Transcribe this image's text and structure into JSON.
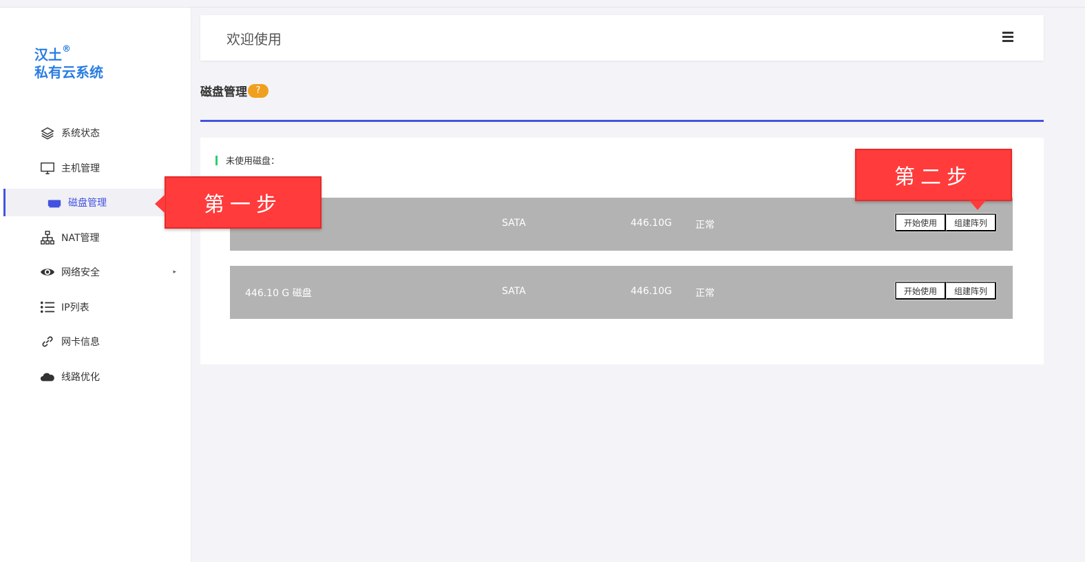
{
  "brand": {
    "name_line1": "汉土",
    "registered": "®",
    "name_line2": "私有云系统"
  },
  "nav": [
    {
      "label": "系统状态",
      "icon": "layers-icon"
    },
    {
      "label": "主机管理",
      "icon": "monitor-icon"
    },
    {
      "label": "磁盘管理",
      "icon": "disk-icon",
      "active": true
    },
    {
      "label": "NAT管理",
      "icon": "network-tree-icon"
    },
    {
      "label": "网络安全",
      "icon": "eye-icon",
      "has_submenu": true,
      "arrow": "▸"
    },
    {
      "label": "IP列表",
      "icon": "list-icon"
    },
    {
      "label": "网卡信息",
      "icon": "link-icon"
    },
    {
      "label": "线路优化",
      "icon": "cloud-icon"
    }
  ],
  "header": {
    "title": "欢迎使用",
    "menu_icon": "hamburger-icon"
  },
  "page": {
    "title": "磁盘管理",
    "help": "?"
  },
  "section": {
    "label": "未使用磁盘："
  },
  "disks": [
    {
      "name": "",
      "type": "SATA",
      "size": "446.10G",
      "status": "正常",
      "btn_use": "开始使用",
      "btn_raid": "组建阵列"
    },
    {
      "name": "446.10 G 磁盘",
      "type": "SATA",
      "size": "446.10G",
      "status": "正常",
      "btn_use": "开始使用",
      "btn_raid": "组建阵列"
    }
  ],
  "callouts": {
    "step1": "第一步",
    "step2": "第二步"
  },
  "colors": {
    "accent": "#4353e0",
    "brand": "#2a7de1",
    "callout": "#ff3b3b",
    "help": "#f0a020",
    "row_bg": "#b3b3b3"
  }
}
